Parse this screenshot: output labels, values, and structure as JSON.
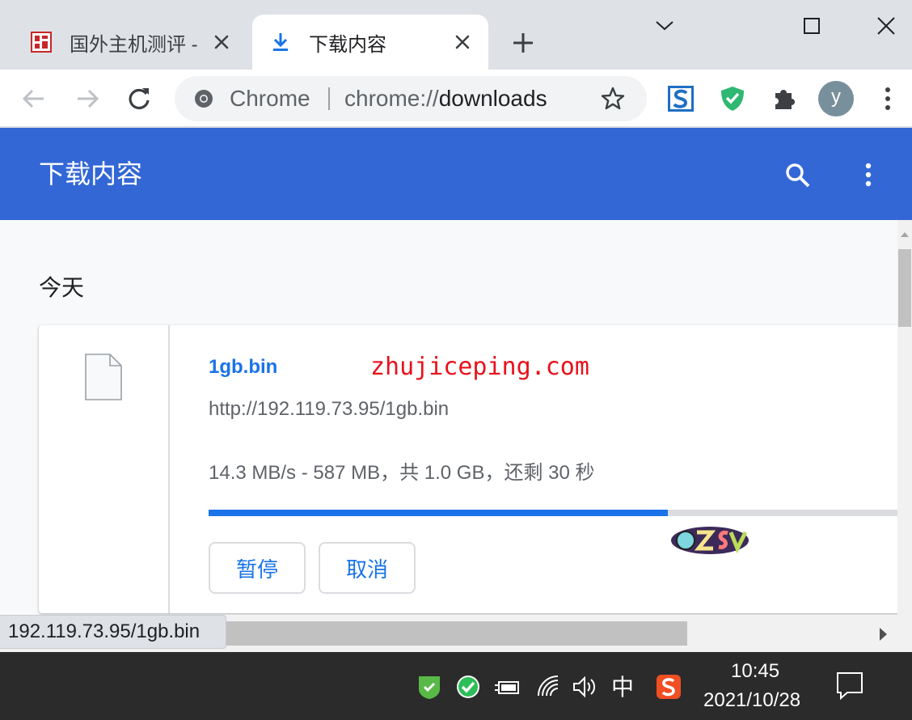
{
  "tabs": [
    {
      "title": "国外主机测评 - ",
      "favicon": "zhujiceping-logo-icon",
      "active": false
    },
    {
      "title": "下载内容",
      "favicon": "download-icon",
      "active": true
    }
  ],
  "window_controls": [
    "chevron-down-icon",
    "maximize-icon",
    "close-icon"
  ],
  "omnibox": {
    "site_chip": "Chrome",
    "url_scheme": "chrome://",
    "url_path": "downloads"
  },
  "extensions": [
    "sogou-s-icon",
    "adguard-shield-icon",
    "puzzle-extensions-icon"
  ],
  "profile": {
    "initial": "y"
  },
  "page": {
    "title": "下载内容",
    "date_group": "今天"
  },
  "download": {
    "file_name": "1gb.bin",
    "url": "http://192.119.73.95/1gb.bin",
    "status": "14.3 MB/s - 587 MB，共 1.0 GB，还剩 30 秒",
    "progress_fraction": 0.653,
    "pause_label": "暂停",
    "cancel_label": "取消",
    "watermark": "zhujiceping.com"
  },
  "status_bubble": "192.119.73.95/1gb.bin",
  "taskbar": {
    "ime": "中",
    "time": "10:45",
    "date": "2021/10/28"
  },
  "colors": {
    "header_blue": "#3367d6",
    "link_blue": "#1a73e8",
    "watermark_red": "#e8111b"
  }
}
